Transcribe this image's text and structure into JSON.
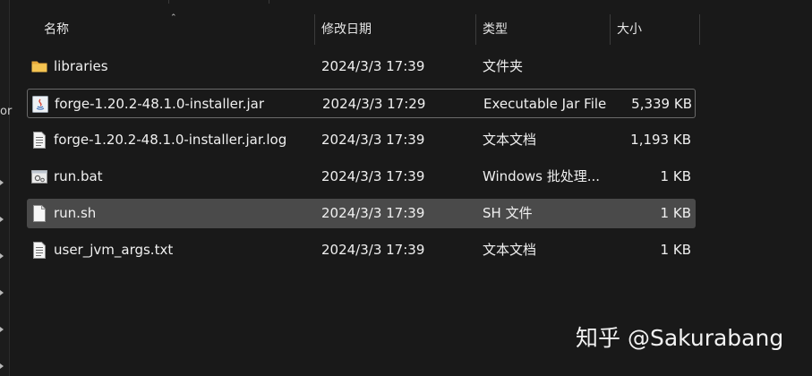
{
  "columns": {
    "name": "名称",
    "date": "修改日期",
    "type": "类型",
    "size": "大小"
  },
  "nav": {
    "partial_text": "or"
  },
  "files": [
    {
      "name": "libraries",
      "date": "2024/3/3 17:39",
      "type": "文件夹",
      "size": "",
      "icon": "folder-icon"
    },
    {
      "name": "forge-1.20.2-48.1.0-installer.jar",
      "date": "2024/3/3 17:29",
      "type": "Executable Jar File",
      "size": "5,339 KB",
      "icon": "java-jar-icon"
    },
    {
      "name": "forge-1.20.2-48.1.0-installer.jar.log",
      "date": "2024/3/3 17:39",
      "type": "文本文档",
      "size": "1,193 KB",
      "icon": "text-document-icon"
    },
    {
      "name": "run.bat",
      "date": "2024/3/3 17:39",
      "type": "Windows 批处理...",
      "size": "1 KB",
      "icon": "batch-file-icon"
    },
    {
      "name": "run.sh",
      "date": "2024/3/3 17:39",
      "type": "SH 文件",
      "size": "1 KB",
      "icon": "blank-file-icon"
    },
    {
      "name": "user_jvm_args.txt",
      "date": "2024/3/3 17:39",
      "type": "文本文档",
      "size": "1 KB",
      "icon": "text-document-icon"
    }
  ],
  "watermark": "知乎 @Sakurabang",
  "colors": {
    "background": "#191919",
    "selected_row": "#4a4a4a",
    "folder": "#f2c14e"
  }
}
